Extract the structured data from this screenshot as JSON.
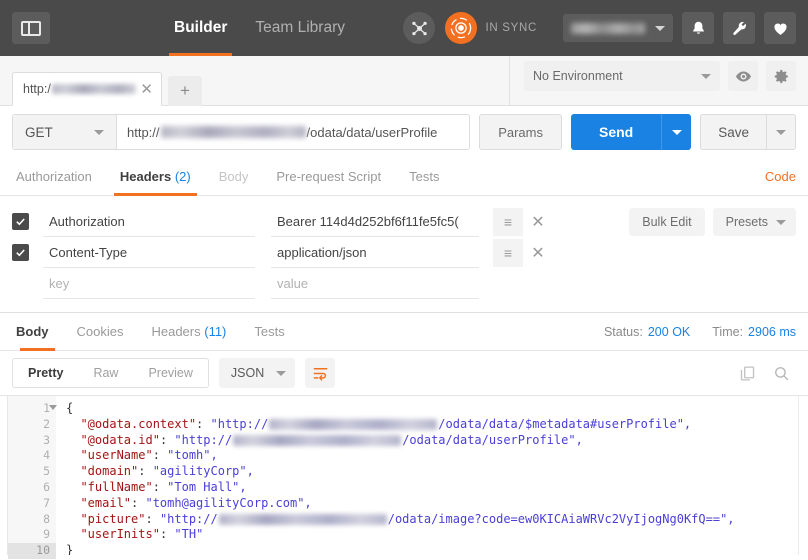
{
  "topbar": {
    "sidebar_toggle_icon": "sidebar-toggle-icon",
    "tabs": [
      {
        "label": "Builder",
        "active": true
      },
      {
        "label": "Team Library",
        "active": false
      }
    ],
    "network_icon": "network-nodes-icon",
    "sync_icon": "sync-orbit-icon",
    "sync_status": "IN SYNC",
    "user_name_blurred": true,
    "icons": [
      "bell-icon",
      "wrench-icon",
      "heart-icon"
    ]
  },
  "tabstrip": {
    "request_tab_prefix": "http:/",
    "request_tab_blurred": true,
    "close_icon": "close-icon",
    "new_tab_label": "+",
    "environment": {
      "selected": "No Environment",
      "eye_icon": "eye-icon",
      "gear_icon": "gear-icon"
    }
  },
  "url_row": {
    "method": "GET",
    "url_prefix": "http://",
    "url_suffix": "/odata/data/userProfile",
    "params_label": "Params",
    "send_label": "Send",
    "save_label": "Save"
  },
  "request_tabs": {
    "items": [
      {
        "label": "Authorization",
        "count": "",
        "active": false,
        "dimmed": false
      },
      {
        "label": "Headers",
        "count": "(2)",
        "active": true,
        "dimmed": false
      },
      {
        "label": "Body",
        "count": "",
        "active": false,
        "dimmed": true
      },
      {
        "label": "Pre-request Script",
        "count": "",
        "active": false,
        "dimmed": false
      },
      {
        "label": "Tests",
        "count": "",
        "active": false,
        "dimmed": false
      }
    ],
    "code_label": "Code"
  },
  "headers": {
    "rows": [
      {
        "checked": true,
        "key": "Authorization",
        "value": "Bearer 114d4d252bf6f11fe5fc5("
      },
      {
        "checked": true,
        "key": "Content-Type",
        "value": "application/json"
      },
      {
        "checked": false,
        "key": "",
        "value": "",
        "key_placeholder": "key",
        "value_placeholder": "value"
      }
    ],
    "menu_icon": "list-menu-icon",
    "delete_icon": "delete-icon",
    "bulk_edit_label": "Bulk Edit",
    "presets_label": "Presets"
  },
  "response": {
    "tabs": [
      {
        "label": "Body",
        "count": "",
        "active": true
      },
      {
        "label": "Cookies",
        "count": "",
        "active": false
      },
      {
        "label": "Headers",
        "count": "(11)",
        "active": false
      },
      {
        "label": "Tests",
        "count": "",
        "active": false
      }
    ],
    "status_label": "Status:",
    "status_value": "200 OK",
    "time_label": "Time:",
    "time_value": "2906 ms",
    "view_modes": [
      {
        "label": "Pretty",
        "active": true
      },
      {
        "label": "Raw",
        "active": false
      },
      {
        "label": "Preview",
        "active": false
      }
    ],
    "format": "JSON",
    "wrap_icon": "word-wrap-icon",
    "copy_icon": "copy-icon",
    "search_icon": "search-icon"
  },
  "body_code": {
    "line_numbers": [
      "1",
      "2",
      "3",
      "4",
      "5",
      "6",
      "7",
      "8",
      "9",
      "10"
    ],
    "lines": [
      {
        "n": 1,
        "text": "{"
      },
      {
        "n": 2,
        "key": "\"@odata.context\"",
        "blurred": true,
        "tail": "/odata/data/$metadata#userProfile\","
      },
      {
        "n": 3,
        "key": "\"@odata.id\"",
        "blurred": true,
        "tail": "/odata/data/userProfile\","
      },
      {
        "n": 4,
        "key": "\"userName\"",
        "value": "\"tomh\","
      },
      {
        "n": 5,
        "key": "\"domain\"",
        "value": "\"agilityCorp\","
      },
      {
        "n": 6,
        "key": "\"fullName\"",
        "value": "\"Tom Hall\","
      },
      {
        "n": 7,
        "key": "\"email\"",
        "value": "\"tomh@agilityCorp.com\","
      },
      {
        "n": 8,
        "key": "\"picture\"",
        "blurred": true,
        "tail": "/odata/image?code=ew0KICAiaWRVc2VyIjogNg0KfQ==\","
      },
      {
        "n": 9,
        "key": "\"userInits\"",
        "value": "\"TH\""
      },
      {
        "n": 10,
        "text": "}"
      }
    ],
    "url_prefix": "\"http://"
  },
  "colors": {
    "accent_orange": "#f37021",
    "link_blue": "#1a82e2",
    "topbar_dark": "#4a4a4a",
    "string_purple": "#4a3fd6",
    "key_red": "#a31515"
  }
}
